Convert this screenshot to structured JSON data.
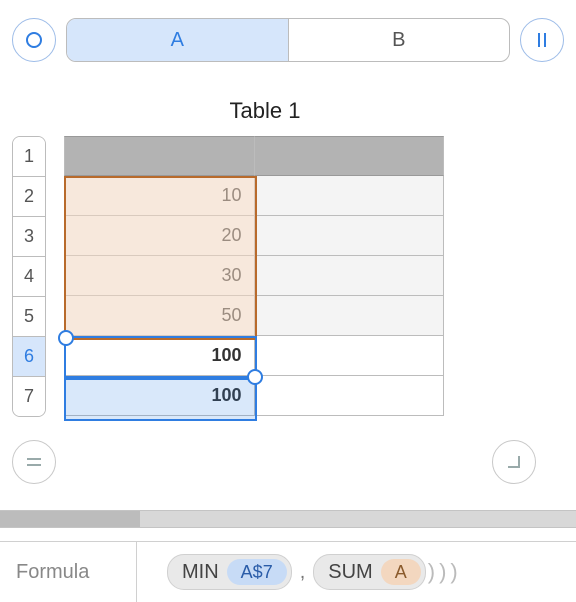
{
  "columns": {
    "a": "A",
    "b": "B",
    "selected": "A"
  },
  "rows": [
    "1",
    "2",
    "3",
    "4",
    "5",
    "6",
    "7"
  ],
  "selected_row": "6",
  "title": "Table 1",
  "cells": {
    "a1": "",
    "a2": "10",
    "a3": "20",
    "a4": "30",
    "a5": "50",
    "a6": "100",
    "a7": "100",
    "b1": "",
    "b2": "",
    "b3": "",
    "b4": "",
    "b5": "",
    "b6": "",
    "b7": ""
  },
  "formula": {
    "label": "Formula",
    "outer_fn": "MIN",
    "arg1_ref": "A$7",
    "comma": ",",
    "inner_fn": "SUM",
    "arg2_ref": "A"
  },
  "icons": {
    "circle": "circle-icon",
    "pause": "pause-icon",
    "equals": "equals-icon",
    "enter": "enter-icon"
  }
}
